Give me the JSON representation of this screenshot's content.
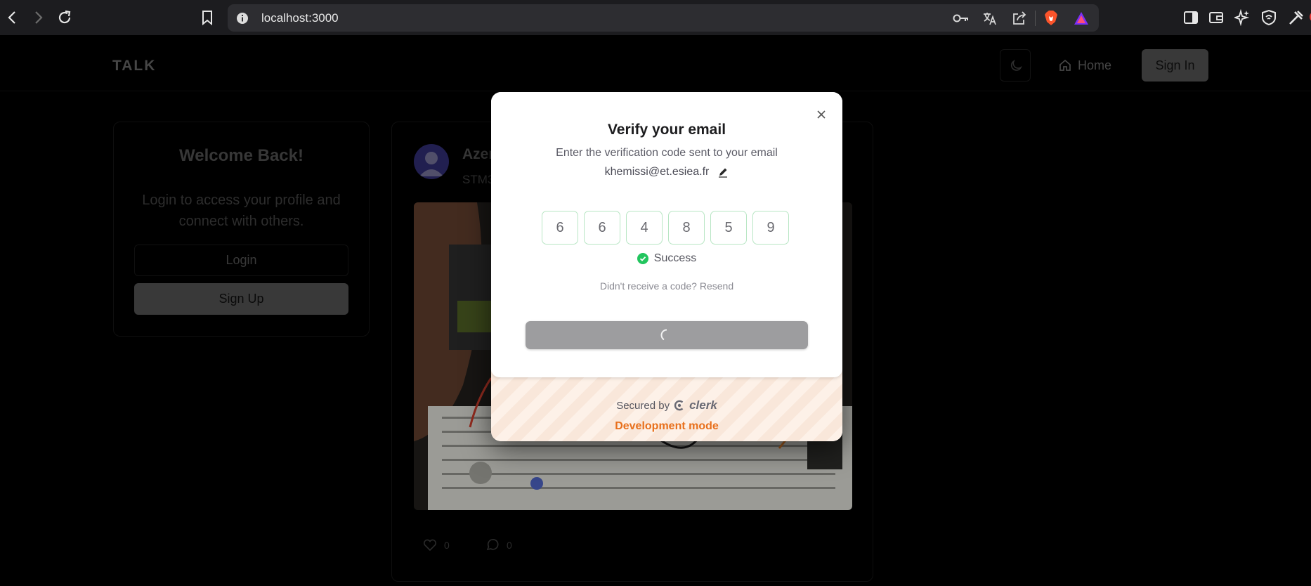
{
  "browser": {
    "url": "localhost:3000",
    "notification_count": "1",
    "accent_brave": "#fb542b"
  },
  "navbar": {
    "brand": "TALK",
    "home_label": "Home",
    "signin_label": "Sign In"
  },
  "welcome": {
    "title": "Welcome Back!",
    "text": "Login to access your profile and connect with others.",
    "login_label": "Login",
    "signup_label": "Sign Up"
  },
  "post": {
    "author": "Azer",
    "subtitle": "STM3",
    "likes": "0",
    "comments": "0"
  },
  "modal": {
    "title": "Verify your email",
    "description": "Enter the verification code sent to your email",
    "email": "khemissi@et.esiea.fr",
    "code": [
      "6",
      "6",
      "4",
      "8",
      "5",
      "9"
    ],
    "status": "Success",
    "resend_text": "Didn't receive a code? Resend",
    "secured_by": "Secured by",
    "provider": "clerk",
    "dev_mode": "Development mode",
    "success_color": "#22c55e",
    "dev_mode_color": "#e8701c"
  }
}
